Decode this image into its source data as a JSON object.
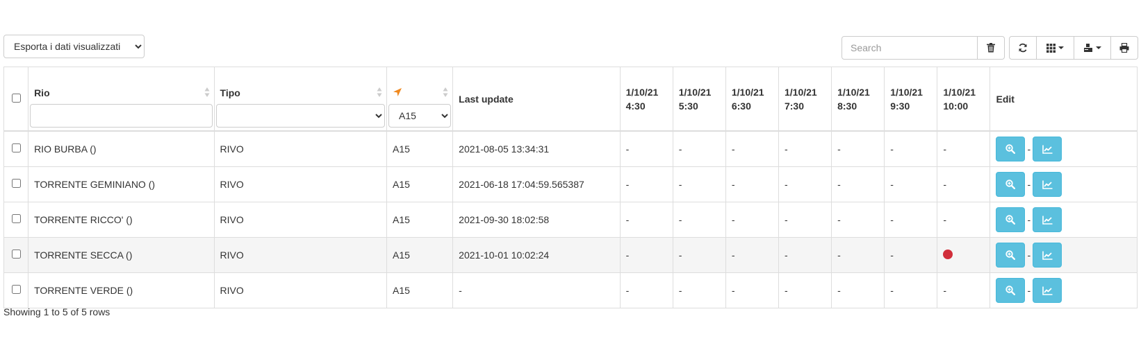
{
  "toolbar": {
    "export_options": [
      "Esporta i dati visualizzati"
    ],
    "export_selected": "Esporta i dati visualizzati",
    "search_placeholder": "Search"
  },
  "table": {
    "headers": {
      "rio": "Rio",
      "tipo": "Tipo",
      "last_update": "Last update",
      "edit": "Edit"
    },
    "filters": {
      "rio_value": "",
      "tipo_value": "",
      "zone_value": "A15",
      "zone_options": [
        "A15"
      ]
    },
    "time_columns": [
      {
        "date": "1/10/21",
        "time": "4:30"
      },
      {
        "date": "1/10/21",
        "time": "5:30"
      },
      {
        "date": "1/10/21",
        "time": "6:30"
      },
      {
        "date": "1/10/21",
        "time": "7:30"
      },
      {
        "date": "1/10/21",
        "time": "8:30"
      },
      {
        "date": "1/10/21",
        "time": "9:30"
      },
      {
        "date": "1/10/21",
        "time": "10:00"
      }
    ],
    "rows": [
      {
        "rio": "RIO BURBA ()",
        "tipo": "RIVO",
        "zone": "A15",
        "last_update": "2021-08-05 13:34:31",
        "values": [
          "-",
          "-",
          "-",
          "-",
          "-",
          "-",
          "-"
        ],
        "separator": "-"
      },
      {
        "rio": "TORRENTE GEMINIANO ()",
        "tipo": "RIVO",
        "zone": "A15",
        "last_update": "2021-06-18 17:04:59.565387",
        "values": [
          "-",
          "-",
          "-",
          "-",
          "-",
          "-",
          "-"
        ],
        "separator": "-"
      },
      {
        "rio": "TORRENTE RICCO' ()",
        "tipo": "RIVO",
        "zone": "A15",
        "last_update": "2021-09-30 18:02:58",
        "values": [
          "-",
          "-",
          "-",
          "-",
          "-",
          "-",
          "-"
        ],
        "separator": "-"
      },
      {
        "rio": "TORRENTE SECCA ()",
        "tipo": "RIVO",
        "zone": "A15",
        "last_update": "2021-10-01 10:02:24",
        "values": [
          "-",
          "-",
          "-",
          "-",
          "-",
          "-",
          "alert-dot"
        ],
        "separator": "-",
        "highlight": true
      },
      {
        "rio": "TORRENTE VERDE ()",
        "tipo": "RIVO",
        "zone": "A15",
        "last_update": "-",
        "values": [
          "-",
          "-",
          "-",
          "-",
          "-",
          "-",
          "-"
        ],
        "separator": "-"
      }
    ]
  },
  "footer": {
    "text": "Showing 1 to 5 of 5 rows"
  },
  "colors": {
    "action_button": "#5bc0de",
    "alert_dot": "#d12e3a",
    "nav_icon": "#f0891f"
  },
  "icons": {
    "clear": "trash-icon",
    "refresh": "refresh-icon",
    "columns": "grid-icon",
    "export": "export-icon",
    "print": "print-icon",
    "zone": "location-arrow-icon",
    "view": "zoom-in-icon",
    "chart": "line-chart-icon"
  }
}
